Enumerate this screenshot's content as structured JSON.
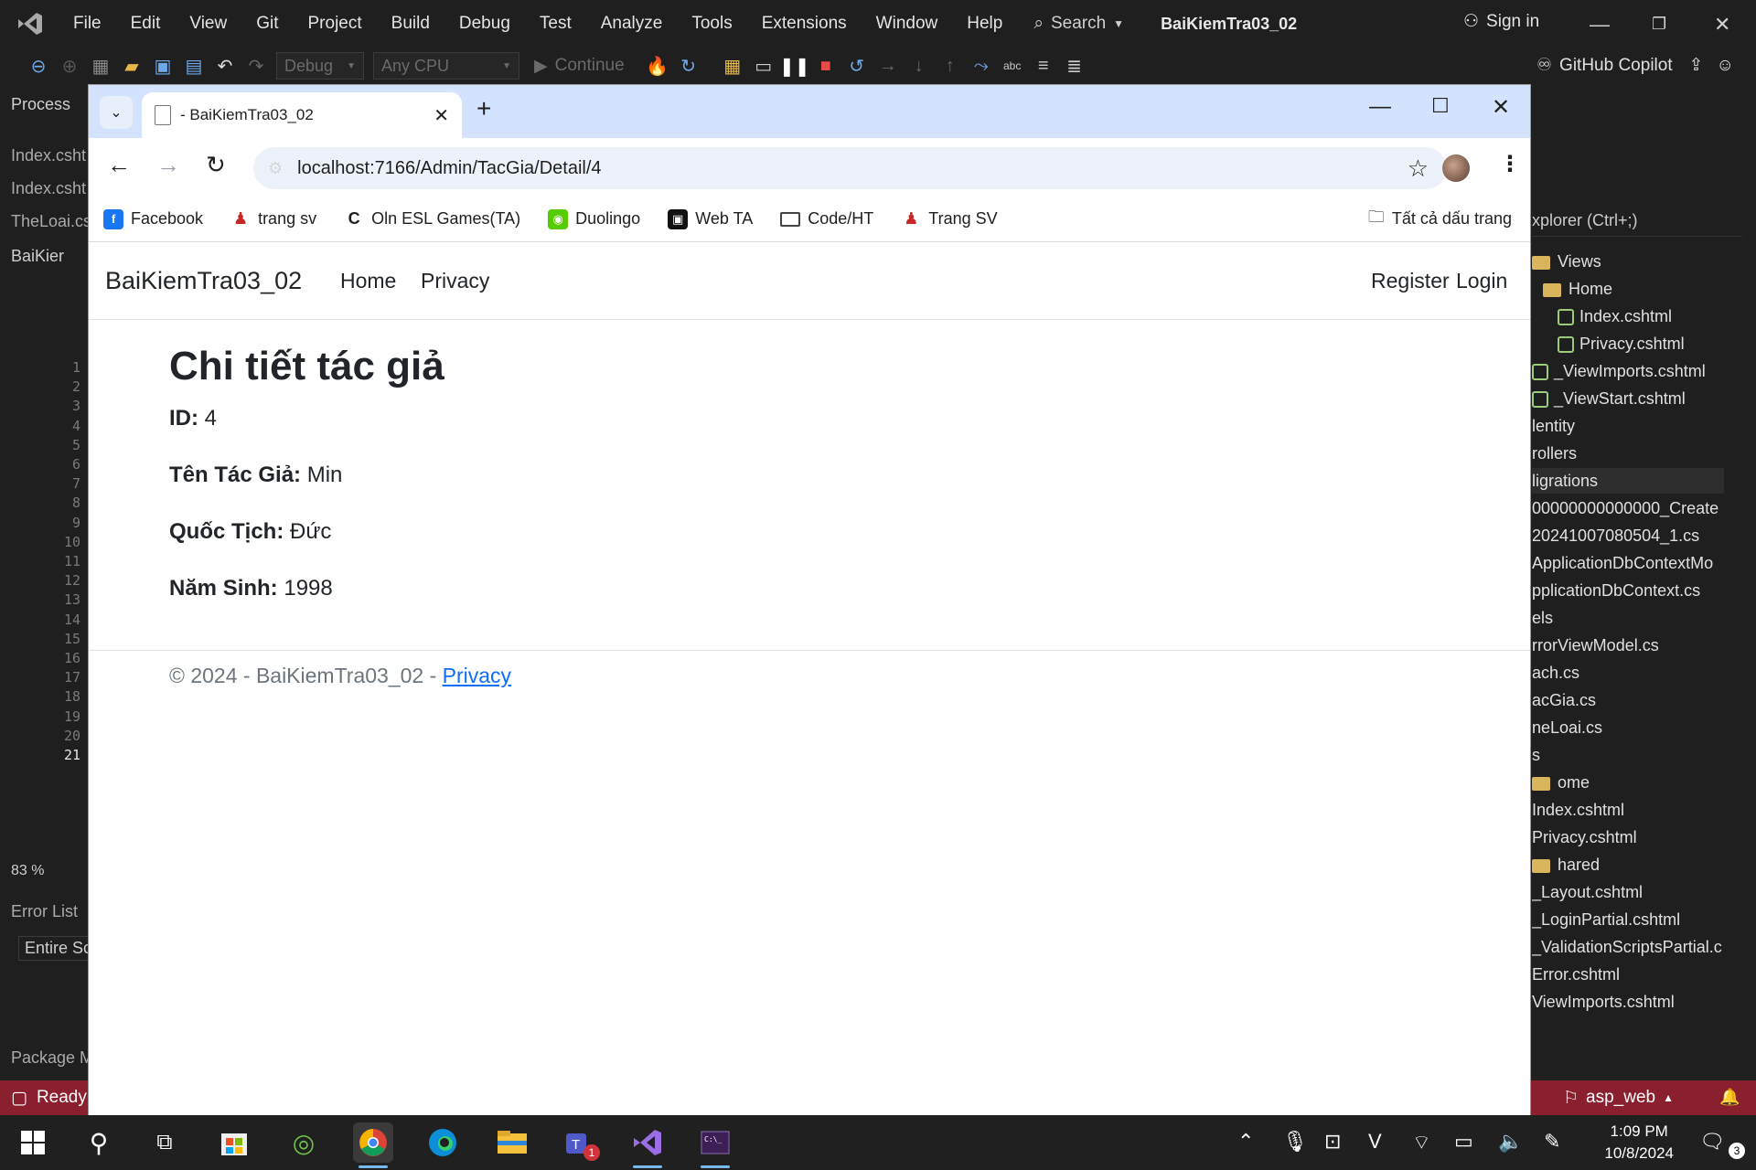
{
  "vs": {
    "menu": [
      "File",
      "Edit",
      "View",
      "Git",
      "Project",
      "Build",
      "Debug",
      "Test",
      "Analyze",
      "Tools",
      "Extensions",
      "Window",
      "Help"
    ],
    "search_label": "Search",
    "solution_name": "BaiKiemTra03_02",
    "sign_in": "Sign in",
    "config": "Debug",
    "platform": "Any CPU",
    "continue": "Continue",
    "copilot": "GitHub Copilot",
    "left_tabs": [
      "Process",
      "Index.csht",
      "Index.csht",
      "TheLoai.cs",
      "BaiKier"
    ],
    "line_numbers": [
      "1",
      "2",
      "3",
      "4",
      "5",
      "6",
      "7",
      "8",
      "9",
      "10",
      "11",
      "12",
      "13",
      "14",
      "15",
      "16",
      "17",
      "18",
      "19",
      "20",
      "21"
    ],
    "zoom": "83 %",
    "error_list": "Error List",
    "entire_sol": "Entire Sc",
    "package": "Package M",
    "explorer_search": "xplorer (Ctrl+;)",
    "tree": [
      "Views",
      "Home",
      "Index.cshtml",
      "Privacy.cshtml",
      "_ViewImports.cshtml",
      "_ViewStart.cshtml",
      "lentity",
      "rollers",
      "ligrations",
      "00000000000000_Create",
      "20241007080504_1.cs",
      "ApplicationDbContextMo",
      "pplicationDbContext.cs",
      "els",
      "rrorViewModel.cs",
      "ach.cs",
      "acGia.cs",
      "neLoai.cs",
      "s",
      "ome",
      "Index.cshtml",
      "Privacy.cshtml",
      "hared",
      "_Layout.cshtml",
      "_LoginPartial.cshtml",
      "_ValidationScriptsPartial.c",
      "Error.cshtml",
      "ViewImports.cshtml"
    ],
    "status": "Ready",
    "branch": "asp_web"
  },
  "browser": {
    "tab_title": "- BaiKiemTra03_02",
    "url": "localhost:7166/Admin/TacGia/Detail/4",
    "bookmarks": [
      {
        "label": "Facebook",
        "color": "#1877f2",
        "glyph": "f"
      },
      {
        "label": "trang sv",
        "color": "#c62828",
        "glyph": "♟"
      },
      {
        "label": "Oln ESL Games(TA)",
        "color": "#1f1f1f",
        "glyph": "C"
      },
      {
        "label": "Duolingo",
        "color": "#58cc02",
        "glyph": "◉"
      },
      {
        "label": "Web TA",
        "color": "#111111",
        "glyph": "▣"
      },
      {
        "label": "Code/HT",
        "color": "#ffffff",
        "glyph": ""
      },
      {
        "label": "Trang SV",
        "color": "#c62828",
        "glyph": "♟"
      }
    ],
    "all_bookmarks": "Tất cả dấu trang"
  },
  "site": {
    "brand": "BaiKiemTra03_02",
    "nav_home": "Home",
    "nav_privacy": "Privacy",
    "nav_register": "Register",
    "nav_login": "Login",
    "heading": "Chi tiết tác giả",
    "fields": [
      {
        "label": "ID:",
        "value": "4"
      },
      {
        "label": "Tên Tác Giả:",
        "value": "Min"
      },
      {
        "label": "Quốc Tịch:",
        "value": "Đức"
      },
      {
        "label": "Năm Sinh:",
        "value": "1998"
      }
    ],
    "footer_text": "© 2024 - BaiKiemTra03_02 - ",
    "footer_link": "Privacy"
  },
  "taskbar": {
    "time": "1:09 PM",
    "date": "10/8/2024",
    "teams_badge": "1",
    "notif_count": "3"
  }
}
